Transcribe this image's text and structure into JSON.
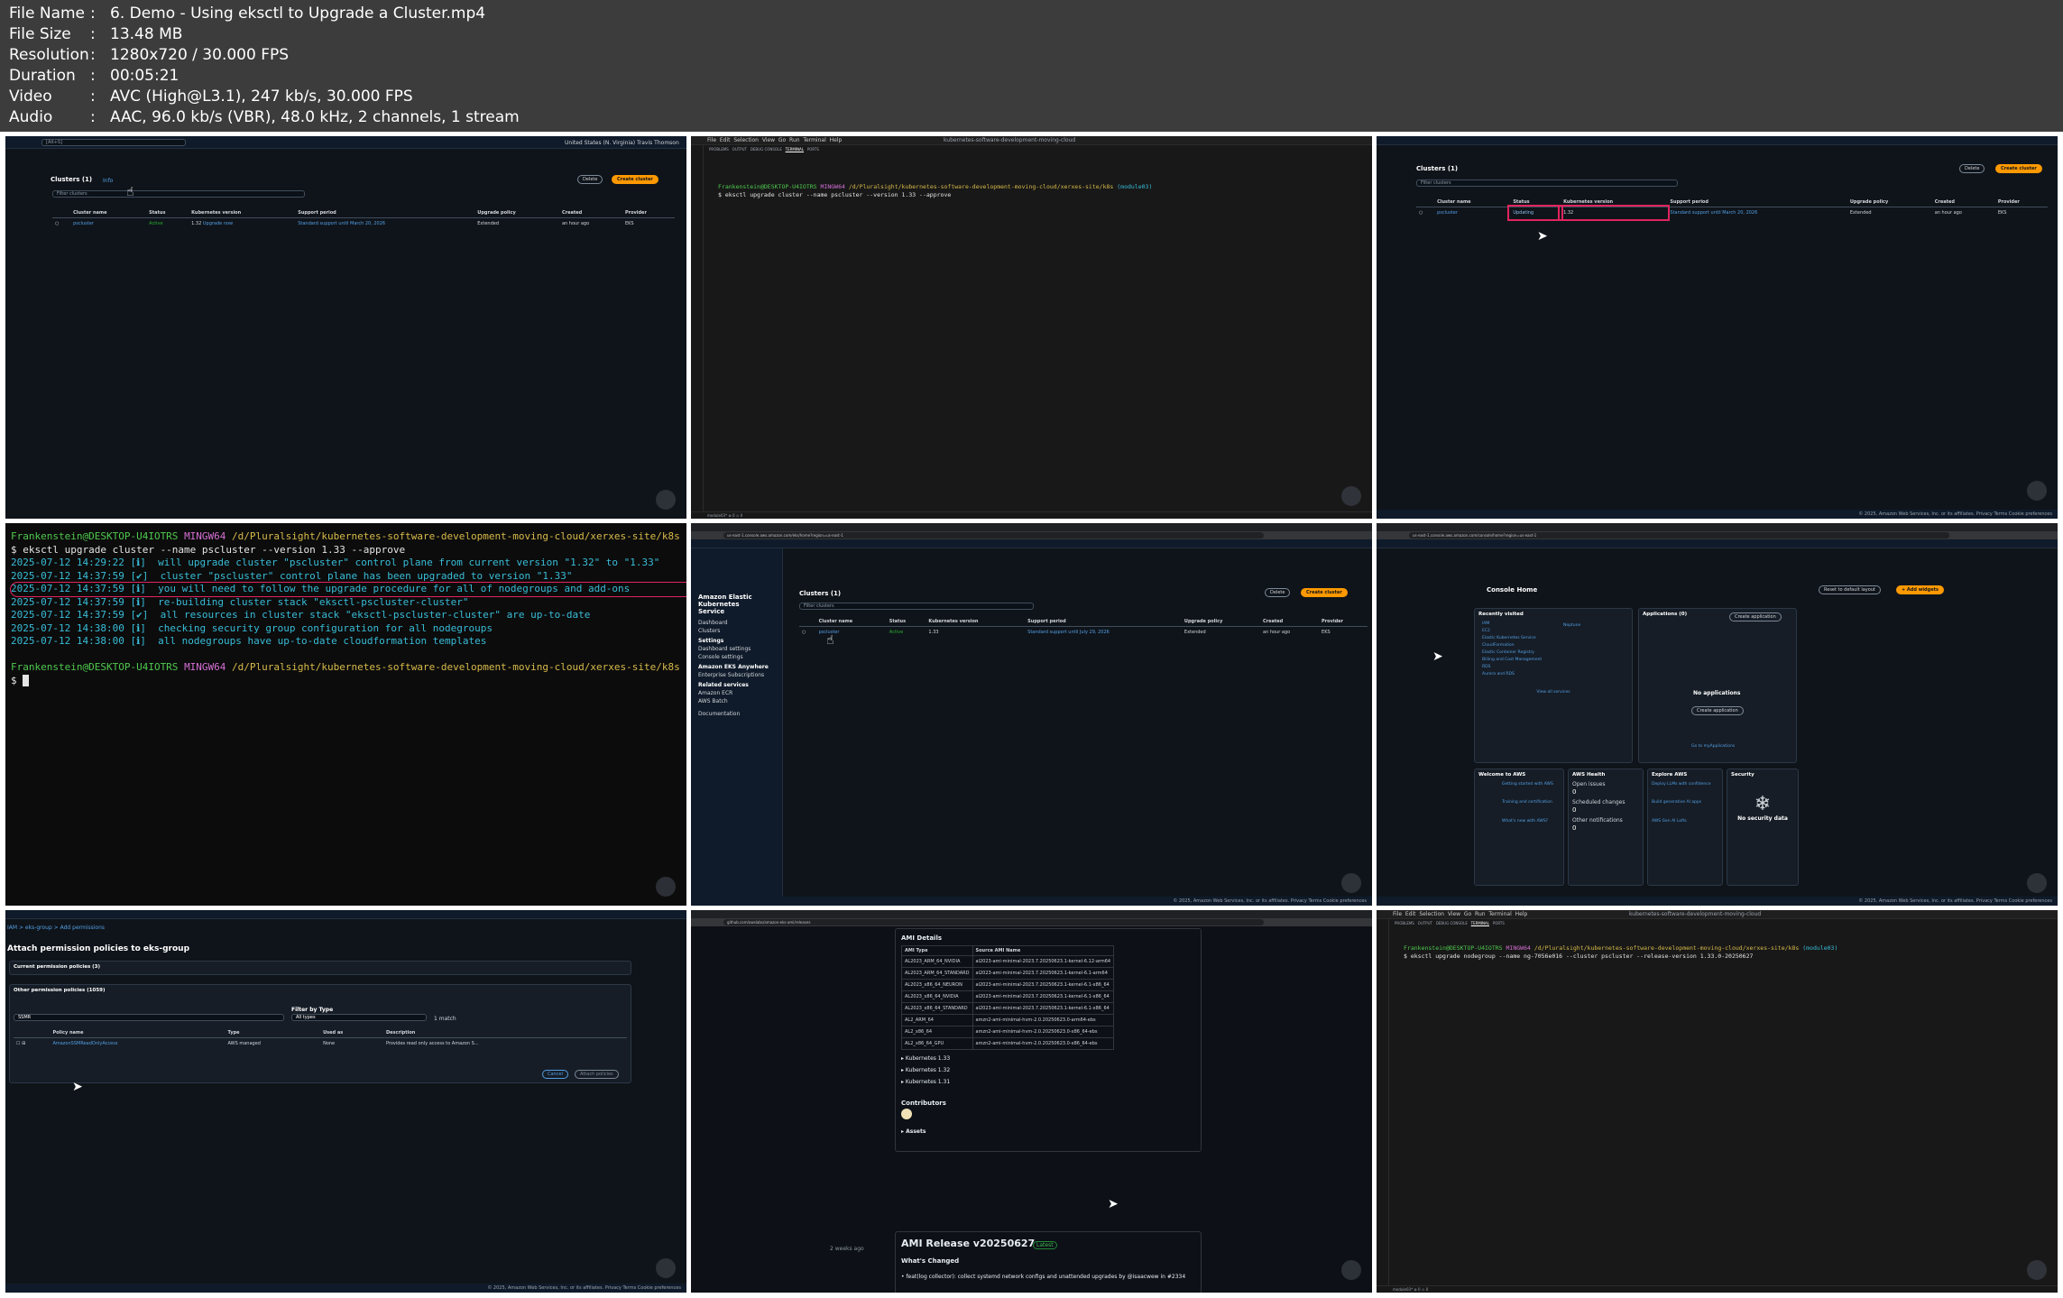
{
  "header": {
    "file_name_label": "File Name",
    "file_name": "6. Demo - Using eksctl to Upgrade a Cluster.mp4",
    "file_size_label": "File Size",
    "file_size": "13.48 MB",
    "resolution_label": "Resolution",
    "resolution": "1280x720 / 30.000 FPS",
    "duration_label": "Duration",
    "duration": "00:05:21",
    "video_label": "Video",
    "video": "AVC (High@L3.1), 247 kb/s, 30.000 FPS",
    "audio_label": "Audio",
    "audio": "AAC, 96.0 kb/s (VBR), 48.0 kHz, 2 channels, 1 stream",
    "separator": ":"
  },
  "clusters_page": {
    "title": "Clusters (1)",
    "info": "Info",
    "filter_placeholder": "Filter clusters",
    "delete_label": "Delete",
    "create_label": "Create cluster",
    "columns": [
      "Cluster name",
      "Status",
      "Kubernetes version",
      "Support period",
      "Upgrade policy",
      "Created",
      "Provider"
    ],
    "row_before": [
      "pscluster",
      "Active",
      "1.32",
      "Upgrade now",
      "Standard support until March 20, 2026",
      "Extended",
      "an hour ago",
      "EKS"
    ],
    "row_updating": [
      "pscluster",
      "Updating",
      "1.32",
      "Standard support until March 20, 2026",
      "Extended",
      "an hour ago",
      "EKS"
    ],
    "row_after": [
      "pscluster",
      "Active",
      "1.33",
      "Standard support until July 29, 2026",
      "Extended",
      "an hour ago",
      "EKS"
    ],
    "region": "United States (N. Virginia)",
    "user": "Travis Thomson",
    "footer": "© 2025, Amazon Web Services, Inc. or its affiliates.   Privacy   Terms   Cookie preferences"
  },
  "terminal": {
    "prompt_user": "Frankenstein@DESKTOP-U4IOTRS",
    "prompt_env": "MINGW64",
    "prompt_path": "/d/Pluralsight/kubernetes-software-development-moving-cloud/xerxes-site/k8s",
    "prompt_branch": "(module03)",
    "cmd_upgrade_cluster": "$ eksctl upgrade cluster --name pscluster --version 1.33 --approve",
    "cmd_upgrade_nodegroup": "$ eksctl upgrade nodegroup --name ng-7056e016 --cluster pscluster --release-version 1.33.0-20250627",
    "output": [
      "2025-07-12 14:29:22 [ℹ]  will upgrade cluster \"pscluster\" control plane from current version \"1.32\" to \"1.33\"",
      "2025-07-12 14:37:59 [✔]  cluster \"pscluster\" control plane has been upgraded to version \"1.33\"",
      "2025-07-12 14:37:59 [ℹ]  you will need to follow the upgrade procedure for all of nodegroups and add-ons",
      "2025-07-12 14:37:59 [ℹ]  re-building cluster stack \"eksctl-pscluster-cluster\"",
      "2025-07-12 14:37:59 [✔]  all resources in cluster stack \"eksctl-pscluster-cluster\" are up-to-date",
      "2025-07-12 14:38:00 [ℹ]  checking security group configuration for all nodegroups",
      "2025-07-12 14:38:00 [ℹ]  all nodegroups have up-to-date cloudformation templates"
    ],
    "final_prompt": "$ "
  },
  "vscode": {
    "menu": [
      "File",
      "Edit",
      "Selection",
      "View",
      "Go",
      "Run",
      "Terminal",
      "Help"
    ],
    "panel_tabs": [
      "PROBLEMS",
      "OUTPUT",
      "DEBUG CONSOLE",
      "TERMINAL",
      "PORTS"
    ],
    "title": "kubernetes-software-development-moving-cloud"
  },
  "eks_nav": {
    "service_title": "Amazon Elastic Kubernetes Service",
    "items": [
      "Dashboard",
      "Clusters",
      "Settings",
      "Dashboard settings",
      "Console settings",
      "Amazon EKS Anywhere",
      "Enterprise Subscriptions",
      "Related services",
      "Amazon ECR",
      "AWS Batch",
      "Documentation"
    ]
  },
  "console_home": {
    "title": "Console Home",
    "reset_label": "Reset to default layout",
    "add_widgets_label": "+ Add widgets",
    "recently_visited": "Recently visited",
    "recent_items": [
      "IAM",
      "EC2",
      "Elastic Kubernetes Service",
      "CloudFormation",
      "Elastic Container Registry",
      "Billing and Cost Management",
      "RDS",
      "Aurora and RDS"
    ],
    "recent_right": "Neptune",
    "view_all": "View all services",
    "applications": "Applications (0)",
    "create_application": "Create application",
    "no_applications": "No applications",
    "go_to_my_apps": "Go to myApplications",
    "welcome": "Welcome to AWS",
    "welcome_items": [
      "Getting started with AWS",
      "Training and certification",
      "What's new with AWS?"
    ],
    "health": "AWS Health",
    "health_items": [
      "Open issues",
      "0",
      "Scheduled changes",
      "0",
      "Other notifications",
      "0"
    ],
    "explore": "Explore AWS",
    "explore_items": [
      "Deploy LLMs with confidence",
      "Build generative AI apps",
      "AWS Gen AI Lofts"
    ],
    "security": "Security",
    "no_security": "No security data"
  },
  "iam": {
    "title": "Attach permission policies to eks-group",
    "current_policies": "Current permission policies (3)",
    "other_policies": "Other permission policies (1059)",
    "filter_label": "Filter by Type",
    "filter_value": "All types",
    "search_value": "SSMR",
    "match": "1 match",
    "columns": [
      "Policy name",
      "Type",
      "Used as",
      "Description"
    ],
    "row": [
      "AmazonSSMReadOnlyAccess",
      "AWS managed",
      "None",
      "Provides read only access to Amazon S..."
    ],
    "cancel": "Cancel",
    "attach": "Attach policies",
    "breadcrumb": "IAM  >  eks-group  >  Add permissions"
  },
  "github": {
    "ami_details": "AMI Details",
    "table_headers": [
      "AMI Type",
      "Source AMI Name"
    ],
    "rows": [
      [
        "AL2023_ARM_64_NVIDIA",
        "al2023-ami-minimal-2023.7.20250623.1-kernel-6.12-arm64"
      ],
      [
        "AL2023_ARM_64_STANDARD",
        "al2023-ami-minimal-2023.7.20250623.1-kernel-6.1-arm64"
      ],
      [
        "AL2023_x86_64_NEURON",
        "al2023-ami-minimal-2023.7.20250623.1-kernel-6.1-x86_64"
      ],
      [
        "AL2023_x86_64_NVIDIA",
        "al2023-ami-minimal-2023.7.20250623.1-kernel-6.1-x86_64"
      ],
      [
        "AL2023_x86_64_STANDARD",
        "al2023-ami-minimal-2023.7.20250623.1-kernel-6.1-x86_64"
      ],
      [
        "AL2_ARM_64",
        "amzn2-ami-minimal-hvm-2.0.20250623.0-arm64-ebs"
      ],
      [
        "AL2_x86_64",
        "amzn2-ami-minimal-hvm-2.0.20250623.0-x86_64-ebs"
      ],
      [
        "AL2_x86_64_GPU",
        "amzn2-ami-minimal-hvm-2.0.20250623.0-x86_64-ebs"
      ]
    ],
    "versions": [
      "▸ Kubernetes 1.33",
      "▸ Kubernetes 1.32",
      "▸ Kubernetes 1.31"
    ],
    "contributors": "Contributors",
    "assets": "▸ Assets",
    "release_title": "AMI Release v20250627",
    "whats_changed": "What's Changed",
    "change_item": "• feat(log collector): collect systemd network configs and unattended upgrades by @isaacwew in #2334",
    "latest": "Latest",
    "weeks_ago": "2 weeks ago"
  },
  "colors": {
    "aws_bg": "#0f141a",
    "aws_orange": "#ff9900",
    "aws_link": "#539fe5",
    "status_green": "#29ad32",
    "highlight_red": "#e0245e"
  }
}
